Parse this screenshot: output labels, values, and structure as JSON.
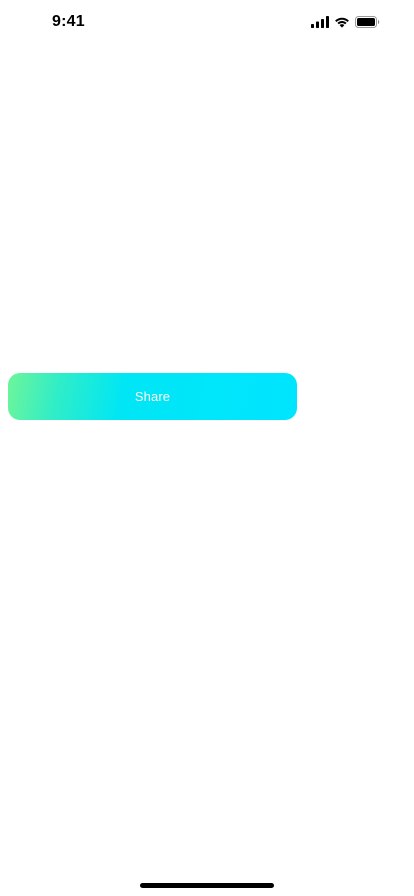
{
  "status_bar": {
    "time": "9:41",
    "icons": [
      "cellular-signal-icon",
      "wifi-icon",
      "battery-icon"
    ]
  },
  "main": {
    "share_button": {
      "label": "Share",
      "gradient_colors": [
        "#6ef59a",
        "#00e5ff"
      ]
    }
  },
  "colors": {
    "background": "#ffffff",
    "text_dark": "#000000",
    "button_text": "#ffffff"
  }
}
